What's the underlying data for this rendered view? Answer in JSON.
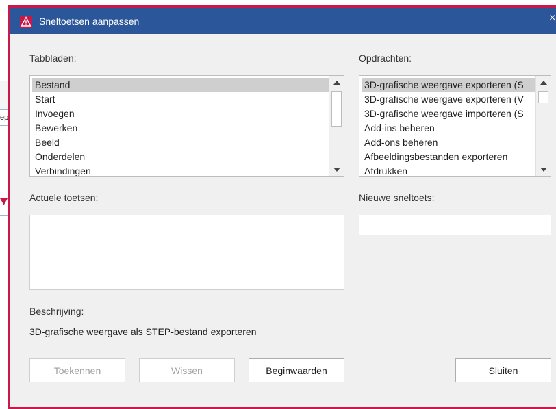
{
  "dialog": {
    "title": "Sneltoetsen aanpassen",
    "close_glyph": "×",
    "accent_color": "#c8194a",
    "titlebar_color": "#2b579a",
    "icon": "warning-triangle-icon"
  },
  "background": {
    "field_text": "ep"
  },
  "tabbladen": {
    "label": "Tabbladen:",
    "items": [
      "Bestand",
      "Start",
      "Invoegen",
      "Bewerken",
      "Beeld",
      "Onderdelen",
      "Verbindingen"
    ],
    "selected_index": 0
  },
  "opdrachten": {
    "label": "Opdrachten:",
    "items": [
      "3D-grafische weergave exporteren (S",
      "3D-grafische weergave exporteren (V",
      "3D-grafische weergave importeren (S",
      "Add-ins beheren",
      "Add-ons beheren",
      "Afbeeldingsbestanden exporteren",
      "Afdrukken"
    ],
    "selected_index": 0
  },
  "actuele_toetsen": {
    "label": "Actuele toetsen:"
  },
  "nieuwe_sneltoets": {
    "label": "Nieuwe sneltoets:",
    "value": ""
  },
  "beschrijving": {
    "label": "Beschrijving:",
    "text": "3D-grafische weergave als STEP-bestand exporteren"
  },
  "buttons": {
    "assign": "Toekennen",
    "clear": "Wissen",
    "reset": "Beginwaarden",
    "close": "Sluiten"
  }
}
